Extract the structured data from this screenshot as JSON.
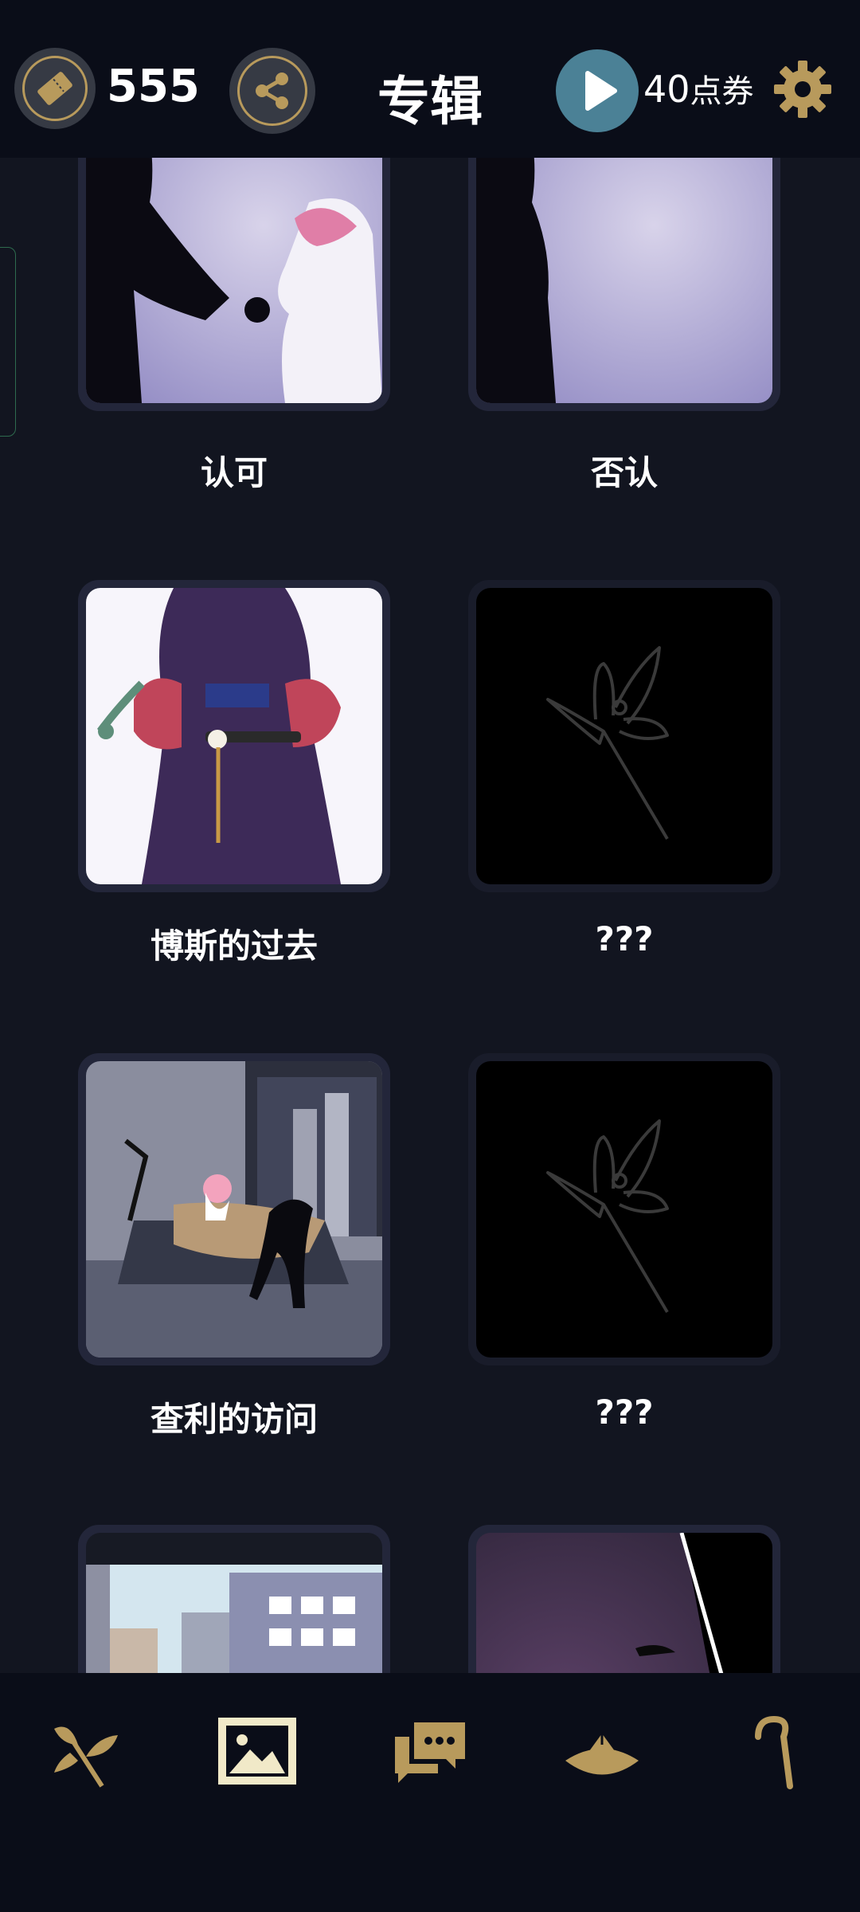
{
  "header": {
    "tickets": "555",
    "title": "专辑",
    "coupon_amount": "40",
    "coupon_unit": "点券"
  },
  "albums": [
    {
      "label": "认可",
      "locked": false
    },
    {
      "label": "否认",
      "locked": false
    },
    {
      "label": "博斯的过去",
      "locked": false
    },
    {
      "label": "???",
      "locked": true
    },
    {
      "label": "查利的访问",
      "locked": false
    },
    {
      "label": "???",
      "locked": true
    },
    {
      "label": "",
      "locked": false
    },
    {
      "label": "",
      "locked": false
    }
  ],
  "bottom_nav": [
    {
      "name": "branch-icon",
      "active": false
    },
    {
      "name": "album-icon",
      "active": true
    },
    {
      "name": "chat-icon",
      "active": false
    },
    {
      "name": "hat-icon",
      "active": false
    },
    {
      "name": "cane-icon",
      "active": false
    }
  ],
  "colors": {
    "gold": "#b89a5c",
    "accent_play": "#4b8196",
    "active_nav": "#f1e9c8"
  }
}
